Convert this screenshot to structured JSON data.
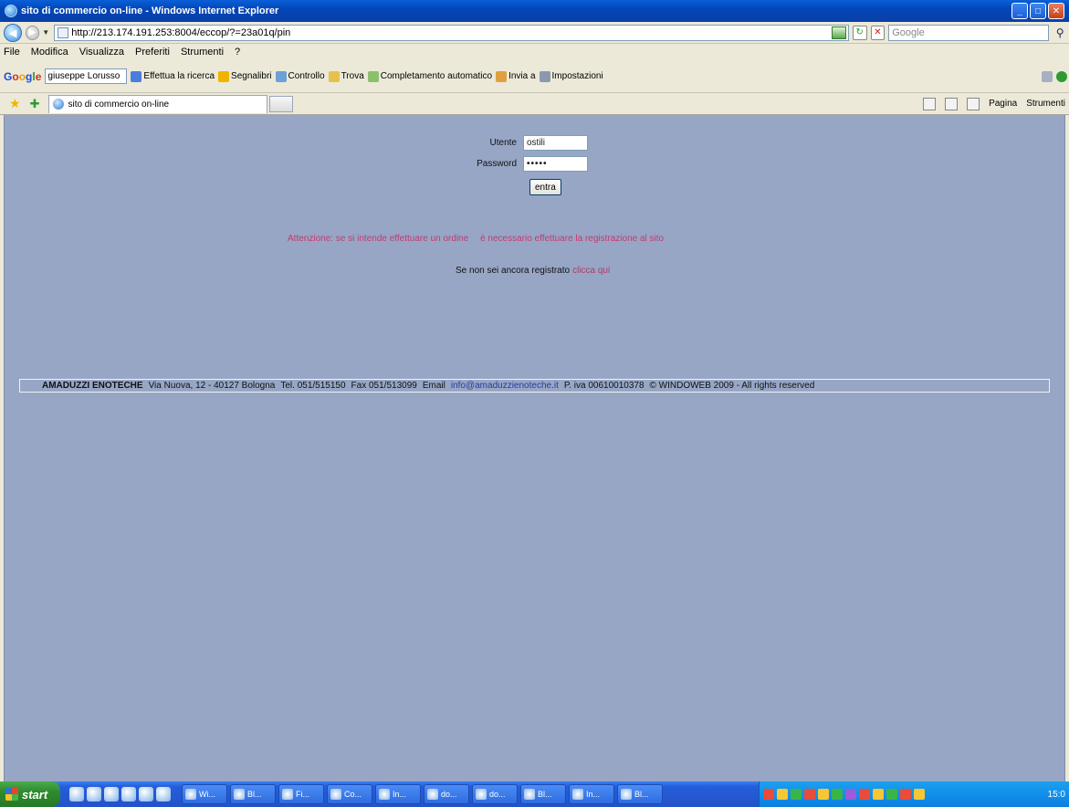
{
  "window": {
    "title": "sito di commercio on-line - Windows Internet Explorer"
  },
  "address": {
    "url": "http://213.174.191.253:8004/eccop/?=23a01q/pin",
    "search_placeholder": "Google"
  },
  "menu": {
    "items": [
      "File",
      "Modifica",
      "Visualizza",
      "Preferiti",
      "Strumenti",
      "?"
    ]
  },
  "googlebar": {
    "search_value": "giuseppe Lorusso",
    "items": [
      "Effettua la ricerca",
      "Segnalibri",
      "Controllo",
      "Trova",
      "Completamento automatico",
      "Invia a",
      "Impostazioni"
    ]
  },
  "tab": {
    "title": "sito di commercio on-line",
    "commands": [
      "Pagina",
      "Strumenti"
    ]
  },
  "login": {
    "user_label": "Utente",
    "user_value": "ostili",
    "password_label": "Password",
    "password_value": "•••••",
    "submit_label": "entra"
  },
  "notice": {
    "part1": "Attenzione: se si intende effettuare un ordine",
    "part2": "è necessario effettuare la registrazione al sito"
  },
  "register": {
    "text": "Se non sei ancora registrato",
    "link": "clicca qui"
  },
  "footer": {
    "brand": "AMADUZZI ENOTECHE",
    "address": "Via Nuova, 12 - 40127 Bologna",
    "tel": "Tel. 051/515150",
    "fax": "Fax 051/513099",
    "email_label": "Email",
    "email": "info@amaduzzienoteche.it",
    "piva": "P. iva 00610010378",
    "copyright": "© WINDOWEB 2009 - All rights reserved"
  },
  "taskbar": {
    "start_label": "start",
    "buttons": [
      "Wi...",
      "Bl...",
      "Fi...",
      "Co...",
      "In...",
      "do...",
      "do...",
      "Bl...",
      "In...",
      "Bl..."
    ],
    "clock": "15:0"
  },
  "colors": {
    "content_bg": "#97a6c5",
    "notice": "#c53970",
    "link": "#b03a6b"
  }
}
